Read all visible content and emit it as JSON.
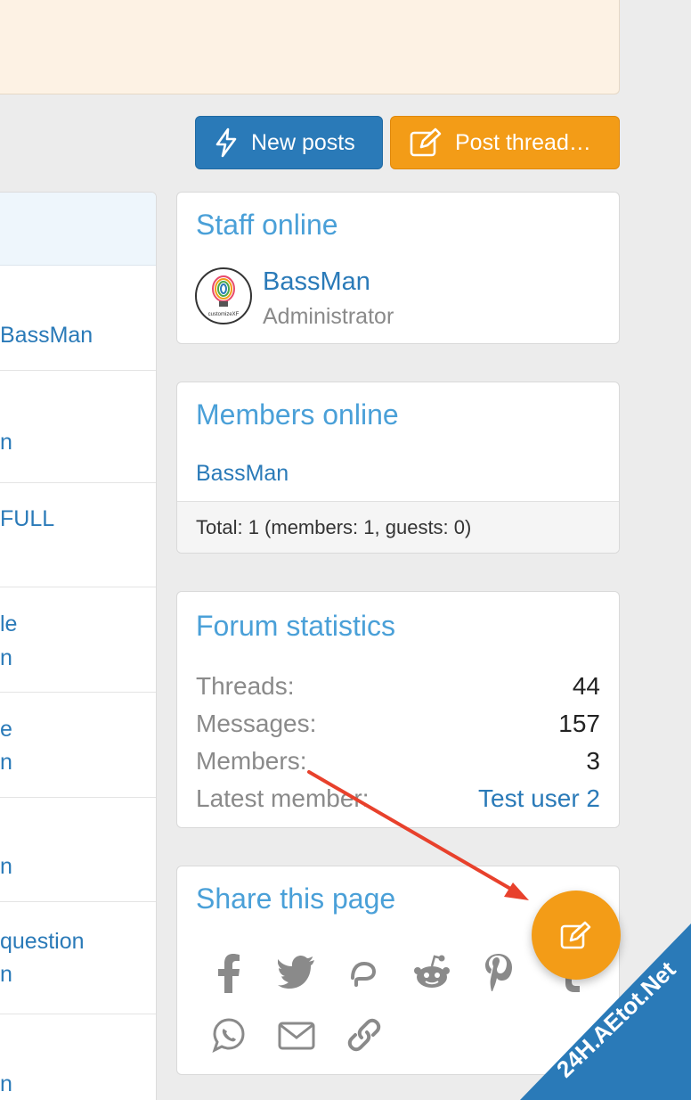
{
  "buttons": {
    "new_posts": "New posts",
    "post_thread": "Post thread…"
  },
  "left_list": {
    "rows": [
      {
        "line1": "",
        "line2": "BassMan"
      },
      {
        "line1": "",
        "line2": "n"
      },
      {
        "line1": "FULL",
        "line2": ""
      },
      {
        "line1": "le",
        "line2": "n"
      },
      {
        "line1": "e",
        "line2": "n"
      },
      {
        "line1": "",
        "line2": "n"
      },
      {
        "line1": "question",
        "line2": "n"
      },
      {
        "line1": "",
        "line2": "n"
      }
    ]
  },
  "staff_online": {
    "title": "Staff online",
    "name": "BassMan",
    "role": "Administrator",
    "avatar_text": "customizeXF"
  },
  "members_online": {
    "title": "Members online",
    "member": "BassMan",
    "total": "Total: 1 (members: 1, guests: 0)"
  },
  "forum_statistics": {
    "title": "Forum statistics",
    "rows": [
      {
        "label": "Threads:",
        "value": "44"
      },
      {
        "label": "Messages:",
        "value": "157"
      },
      {
        "label": "Members:",
        "value": "3"
      },
      {
        "label": "Latest member:",
        "value": "Test user 2"
      }
    ]
  },
  "share": {
    "title": "Share this page",
    "icons": [
      "facebook-icon",
      "twitter-icon",
      "gettr-icon",
      "reddit-icon",
      "pinterest-icon",
      "tumblr-icon",
      "whatsapp-icon",
      "email-icon",
      "link-icon"
    ]
  },
  "watermark": "24H.AEtot.Net",
  "colors": {
    "blue_button": "#2a7ab8",
    "orange_button": "#f39c17",
    "title_blue": "#4aa0d8",
    "arrow_red": "#e8412c"
  }
}
